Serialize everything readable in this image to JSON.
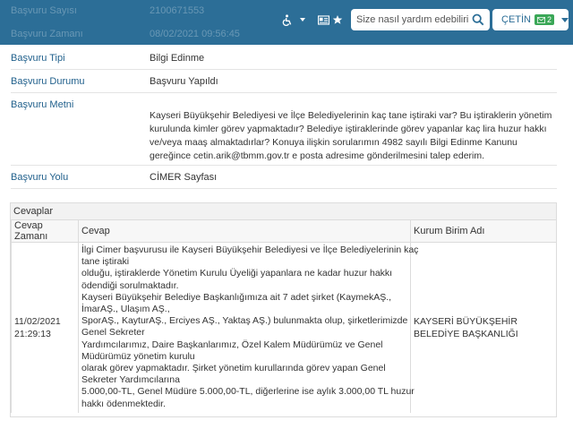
{
  "header": {
    "ghost_rows": [
      {
        "label": "Başvuru Sayısı",
        "value": "2100671553"
      },
      {
        "label": "Başvuru Zamanı",
        "value": "08/02/2021 09:56:45"
      }
    ],
    "accessibility_icon": "wheelchair-icon",
    "card_icon": "id-card-icon",
    "star_icon": "star-icon",
    "search": {
      "placeholder": "Size nasıl yardım edebilirim?"
    },
    "user": {
      "name": "ÇETİN",
      "badge_count": "2"
    },
    "colors": {
      "bar": "#2c6e97",
      "badge": "#3aa757",
      "label": "#1f5f8b"
    }
  },
  "details": [
    {
      "label": "Başvuru Tipi",
      "value": "Bilgi Edinme"
    },
    {
      "label": "Başvuru Durumu",
      "value": "Başvuru Yapıldı"
    },
    {
      "label": "Başvuru Metni",
      "value": "Kayseri Büyükşehir Belediyesi ve İlçe Belediyelerinin kaç tane iştiraki var? Bu iştiraklerin yönetim kurulunda kimler görev yapmaktadır? Belediye iştiraklerinde görev yapanlar kaç lira huzur hakkı ve/veya maaş almaktadırlar? Konuya ilişkin sorularımın 4982 sayılı Bilgi Edinme Kanunu gereğince cetin.arik@tbmm.gov.tr e posta adresime gönderilmesini talep ederim."
    },
    {
      "label": "Başvuru Yolu",
      "value": "CİMER Sayfası"
    }
  ],
  "cevaplar": {
    "title": "Cevaplar",
    "columns": [
      "Cevap Zamanı",
      "Cevap",
      "Kurum Birim Adı"
    ],
    "rows": [
      {
        "time": "11/02/2021 21:29:13",
        "lines": [
          "İlgi Cimer başvurusu ile Kayseri Büyükşehir Belediyesi ve İlçe Belediyelerinin kaç",
          "tane iştiraki",
          "olduğu, iştiraklerde Yönetim Kurulu Üyeliği yapanlara ne kadar huzur hakkı",
          "ödendiği sorulmaktadır.",
          "Kayseri Büyükşehir Belediye Başkanlığımıza ait 7 adet şirket (KaymekAŞ.,",
          "İmarAŞ., Ulaşım AŞ.,",
          "SporAŞ., KayturAŞ., Erciyes AŞ., Yaktaş AŞ.) bulunmakta olup, şirketlerimizde",
          "Genel Sekreter",
          "Yardımcılarımız, Daire Başkanlarımız, Özel Kalem Müdürümüz ve Genel",
          "Müdürümüz yönetim kurulu",
          "olarak görev yapmaktadır. Şirket yönetim kurullarında görev yapan Genel",
          "Sekreter Yardımcılarına",
          "5.000,00-TL, Genel Müdüre 5.000,00-TL, diğerlerine ise aylık 3.000,00 TL huzur",
          "hakkı ödenmektedir."
        ],
        "unit": "KAYSERİ BÜYÜKŞEHİR BELEDİYE BAŞKANLIĞI"
      }
    ]
  }
}
